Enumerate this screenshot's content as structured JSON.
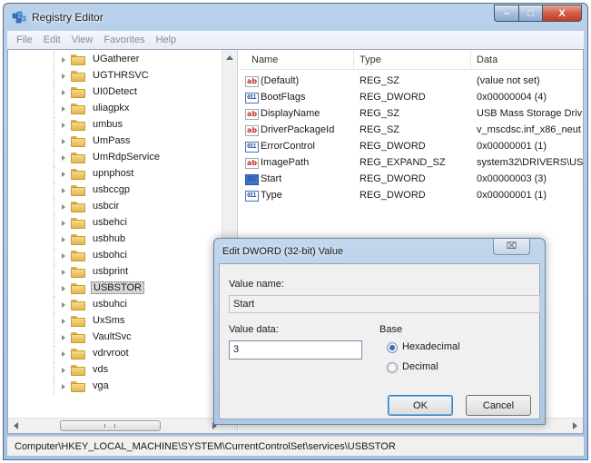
{
  "window": {
    "title": "Registry Editor",
    "caption_buttons": {
      "minimize": "–",
      "maximize": "□",
      "close": "X"
    }
  },
  "menu": [
    "File",
    "Edit",
    "View",
    "Favorites",
    "Help"
  ],
  "tree": {
    "items": [
      {
        "label": "UGatherer",
        "selected": false
      },
      {
        "label": "UGTHRSVC",
        "selected": false
      },
      {
        "label": "UI0Detect",
        "selected": false
      },
      {
        "label": "uliagpkx",
        "selected": false
      },
      {
        "label": "umbus",
        "selected": false
      },
      {
        "label": "UmPass",
        "selected": false
      },
      {
        "label": "UmRdpService",
        "selected": false
      },
      {
        "label": "upnphost",
        "selected": false
      },
      {
        "label": "usbccgp",
        "selected": false
      },
      {
        "label": "usbcir",
        "selected": false
      },
      {
        "label": "usbehci",
        "selected": false
      },
      {
        "label": "usbhub",
        "selected": false
      },
      {
        "label": "usbohci",
        "selected": false
      },
      {
        "label": "usbprint",
        "selected": false
      },
      {
        "label": "USBSTOR",
        "selected": true
      },
      {
        "label": "usbuhci",
        "selected": false
      },
      {
        "label": "UxSms",
        "selected": false
      },
      {
        "label": "VaultSvc",
        "selected": false
      },
      {
        "label": "vdrvroot",
        "selected": false
      },
      {
        "label": "vds",
        "selected": false
      },
      {
        "label": "vga",
        "selected": false
      }
    ]
  },
  "values": {
    "columns": {
      "name": "Name",
      "type": "Type",
      "data": "Data"
    },
    "rows": [
      {
        "name": "(Default)",
        "type": "REG_SZ",
        "data": "(value not set)",
        "icon": "string-value-icon"
      },
      {
        "name": "BootFlags",
        "type": "REG_DWORD",
        "data": "0x00000004 (4)",
        "icon": "dword-value-icon"
      },
      {
        "name": "DisplayName",
        "type": "REG_SZ",
        "data": "USB Mass Storage Driv",
        "icon": "string-value-icon"
      },
      {
        "name": "DriverPackageId",
        "type": "REG_SZ",
        "data": "v_mscdsc.inf_x86_neut",
        "icon": "string-value-icon"
      },
      {
        "name": "ErrorControl",
        "type": "REG_DWORD",
        "data": "0x00000001 (1)",
        "icon": "dword-value-icon"
      },
      {
        "name": "ImagePath",
        "type": "REG_EXPAND_SZ",
        "data": "system32\\DRIVERS\\US",
        "icon": "string-value-icon"
      },
      {
        "name": "Start",
        "type": "REG_DWORD",
        "data": "0x00000003 (3)",
        "icon": "dword-value-icon"
      },
      {
        "name": "Type",
        "type": "REG_DWORD",
        "data": "0x00000001 (1)",
        "icon": "dword-value-icon"
      }
    ]
  },
  "status": {
    "path": "Computer\\HKEY_LOCAL_MACHINE\\SYSTEM\\CurrentControlSet\\services\\USBSTOR"
  },
  "dialog": {
    "title": "Edit DWORD (32-bit) Value",
    "close_label": "⌧",
    "value_name_label": "Value name:",
    "value_name": "Start",
    "value_data_label": "Value data:",
    "value_data": "3",
    "base_label": "Base",
    "radio_hex": "Hexadecimal",
    "radio_dec": "Decimal",
    "base_selected": "Hexadecimal",
    "ok": "OK",
    "cancel": "Cancel"
  }
}
